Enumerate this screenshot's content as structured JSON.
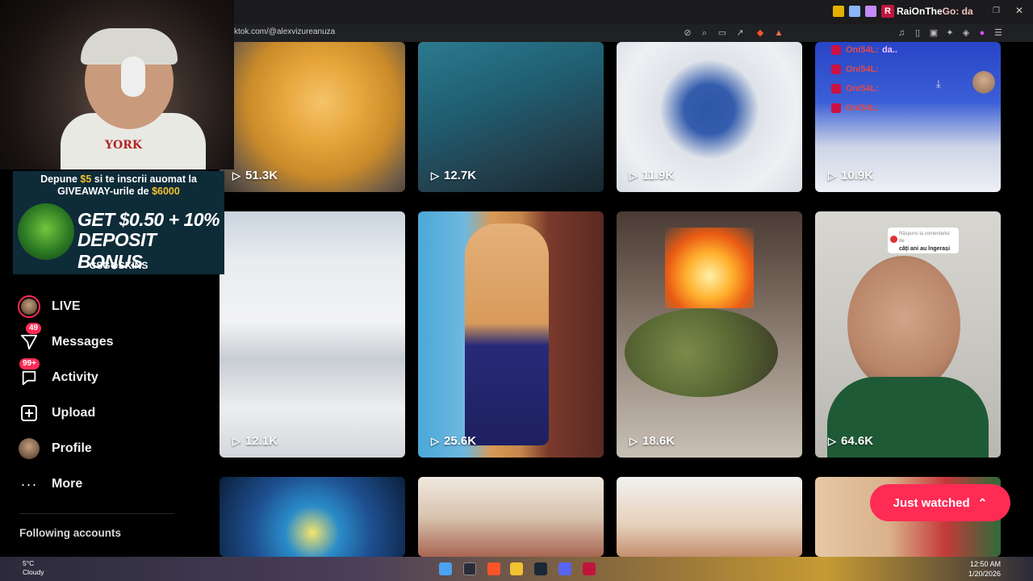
{
  "browser": {
    "url": "ktok.com/@alexvizureanuza",
    "stream_title": "RaiOnThe",
    "stream_suffix": "Go: da"
  },
  "ad": {
    "line1_pre": "Depune ",
    "line1_amount": "$5",
    "line1_post": " si te inscrii auomat la",
    "line2_pre": "GIVEAWAY-urile de ",
    "line2_amount": "$6000",
    "big1": "GET $0.50 + 10%",
    "big2": "DEPOSIT BONUS",
    "brand": "CSG⊙SKINS"
  },
  "sidebar": {
    "items": [
      {
        "label": "LIVE",
        "icon": "live-avatar-icon"
      },
      {
        "label": "Messages",
        "icon": "paper-plane-icon",
        "badge": "49"
      },
      {
        "label": "Activity",
        "icon": "activity-icon",
        "badge": "99+"
      },
      {
        "label": "Upload",
        "icon": "plus-square-icon"
      },
      {
        "label": "Profile",
        "icon": "profile-avatar-icon"
      },
      {
        "label": "More",
        "icon": "more-dots-icon"
      }
    ],
    "following_title": "Following accounts"
  },
  "videos": [
    {
      "views": "51.3K",
      "scene": "eggs in pot"
    },
    {
      "views": "12.7K",
      "scene": "blue jacket"
    },
    {
      "views": "11.9K",
      "scene": "child on sled"
    },
    {
      "views": "10.9K",
      "scene": "kids on sled"
    },
    {
      "views": "12.1K",
      "scene": "snowy road"
    },
    {
      "views": "25.6K",
      "scene": "dancing woman"
    },
    {
      "views": "18.6K",
      "scene": "fire in stove"
    },
    {
      "views": "64.6K",
      "scene": "man selfie"
    },
    {
      "views": "",
      "scene": "blue light"
    },
    {
      "views": "",
      "scene": "children"
    },
    {
      "views": "",
      "scene": "child"
    },
    {
      "views": "",
      "scene": "child christmas"
    }
  ],
  "reply_overlay": {
    "line1": "Răspuns la comentariul de",
    "line2": "câți ani au îngerași"
  },
  "just_watched": "Just watched",
  "chat": {
    "messages": [
      {
        "user": "Oni54L:",
        "text": "da.."
      },
      {
        "user": "Oni54L:",
        "text": ""
      },
      {
        "user": "Oni54L:",
        "text": ""
      },
      {
        "user": "Oni54L:",
        "text": ""
      }
    ]
  },
  "taskbar": {
    "weather_temp": "5°C",
    "weather_desc": "Cloudy",
    "time": "12:50 AM",
    "date": "1/20/2026"
  },
  "webcam": {
    "shirt_text": "YORK"
  }
}
